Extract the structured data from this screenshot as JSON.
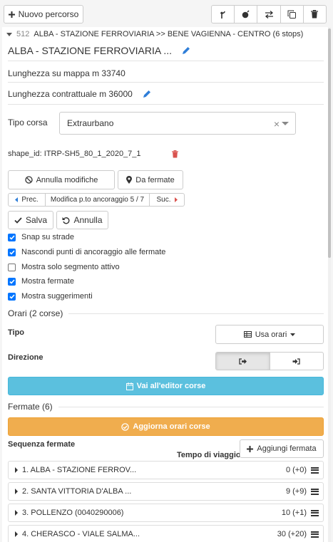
{
  "toolbar": {
    "new_route_label": "Nuovo percorso",
    "tools": [
      "fork-icon",
      "bomb-icon",
      "swap-icon",
      "copy-icon",
      "trash-icon"
    ]
  },
  "route": {
    "number": "512",
    "header": "ALBA - STAZIONE FERROVIARIA >> BENE VAGIENNA - CENTRO (6 stops)",
    "title": "ALBA - STAZIONE FERROVIARIA ..."
  },
  "lengths": {
    "map_length": "Lunghezza su mappa m 33740",
    "contract_length": "Lunghezza contrattuale m 36000"
  },
  "trip_type": {
    "label": "Tipo corsa",
    "value": "Extraurbano"
  },
  "shape_id": "shape_id: ITRP-SH5_80_1_2020_7_1",
  "actions": {
    "undo_changes": "Annulla modifiche",
    "from_stops": "Da fermate"
  },
  "anchor_nav": {
    "prev": "Prec.",
    "status": "Modifica p.to ancoraggio 5 / 7",
    "next": "Suc."
  },
  "edit_actions": {
    "save": "Salva",
    "cancel": "Annulla"
  },
  "options": [
    {
      "label": "Snap su strade",
      "checked": true
    },
    {
      "label": "Nascondi punti di ancoraggio alle fermate",
      "checked": true
    },
    {
      "label": "Mostra solo segmento attivo",
      "checked": false
    },
    {
      "label": "Mostra fermate",
      "checked": true
    },
    {
      "label": "Mostra suggerimenti",
      "checked": true
    }
  ],
  "schedules": {
    "title": "Orari (2 corse)",
    "type_label": "Tipo",
    "type_button": "Usa orari",
    "direction_label": "Direzione",
    "editor_button": "Vai all'editor corse"
  },
  "stops_section": {
    "title": "Fermate (6)",
    "update_button": "Aggiorna orari corse",
    "sequence_label": "Sequenza fermate",
    "travel_time_label": "Tempo di viaggio",
    "add_stop": "Aggiungi fermata",
    "stops": [
      {
        "name": "1. ALBA - STAZIONE FERROV...",
        "time": "0 (+0)"
      },
      {
        "name": "2. SANTA VITTORIA D'ALBA ...",
        "time": "9 (+9)"
      },
      {
        "name": "3. POLLENZO (0040290006)",
        "time": "10 (+1)"
      },
      {
        "name": "4. CHERASCO - VIALE SALMA...",
        "time": "30 (+20)"
      }
    ]
  },
  "colors": {
    "accent_blue": "#2f7ed8",
    "info": "#5bc0de",
    "warning": "#f0ad4e",
    "danger": "#d9534f",
    "checkbox": "#0075ff"
  }
}
